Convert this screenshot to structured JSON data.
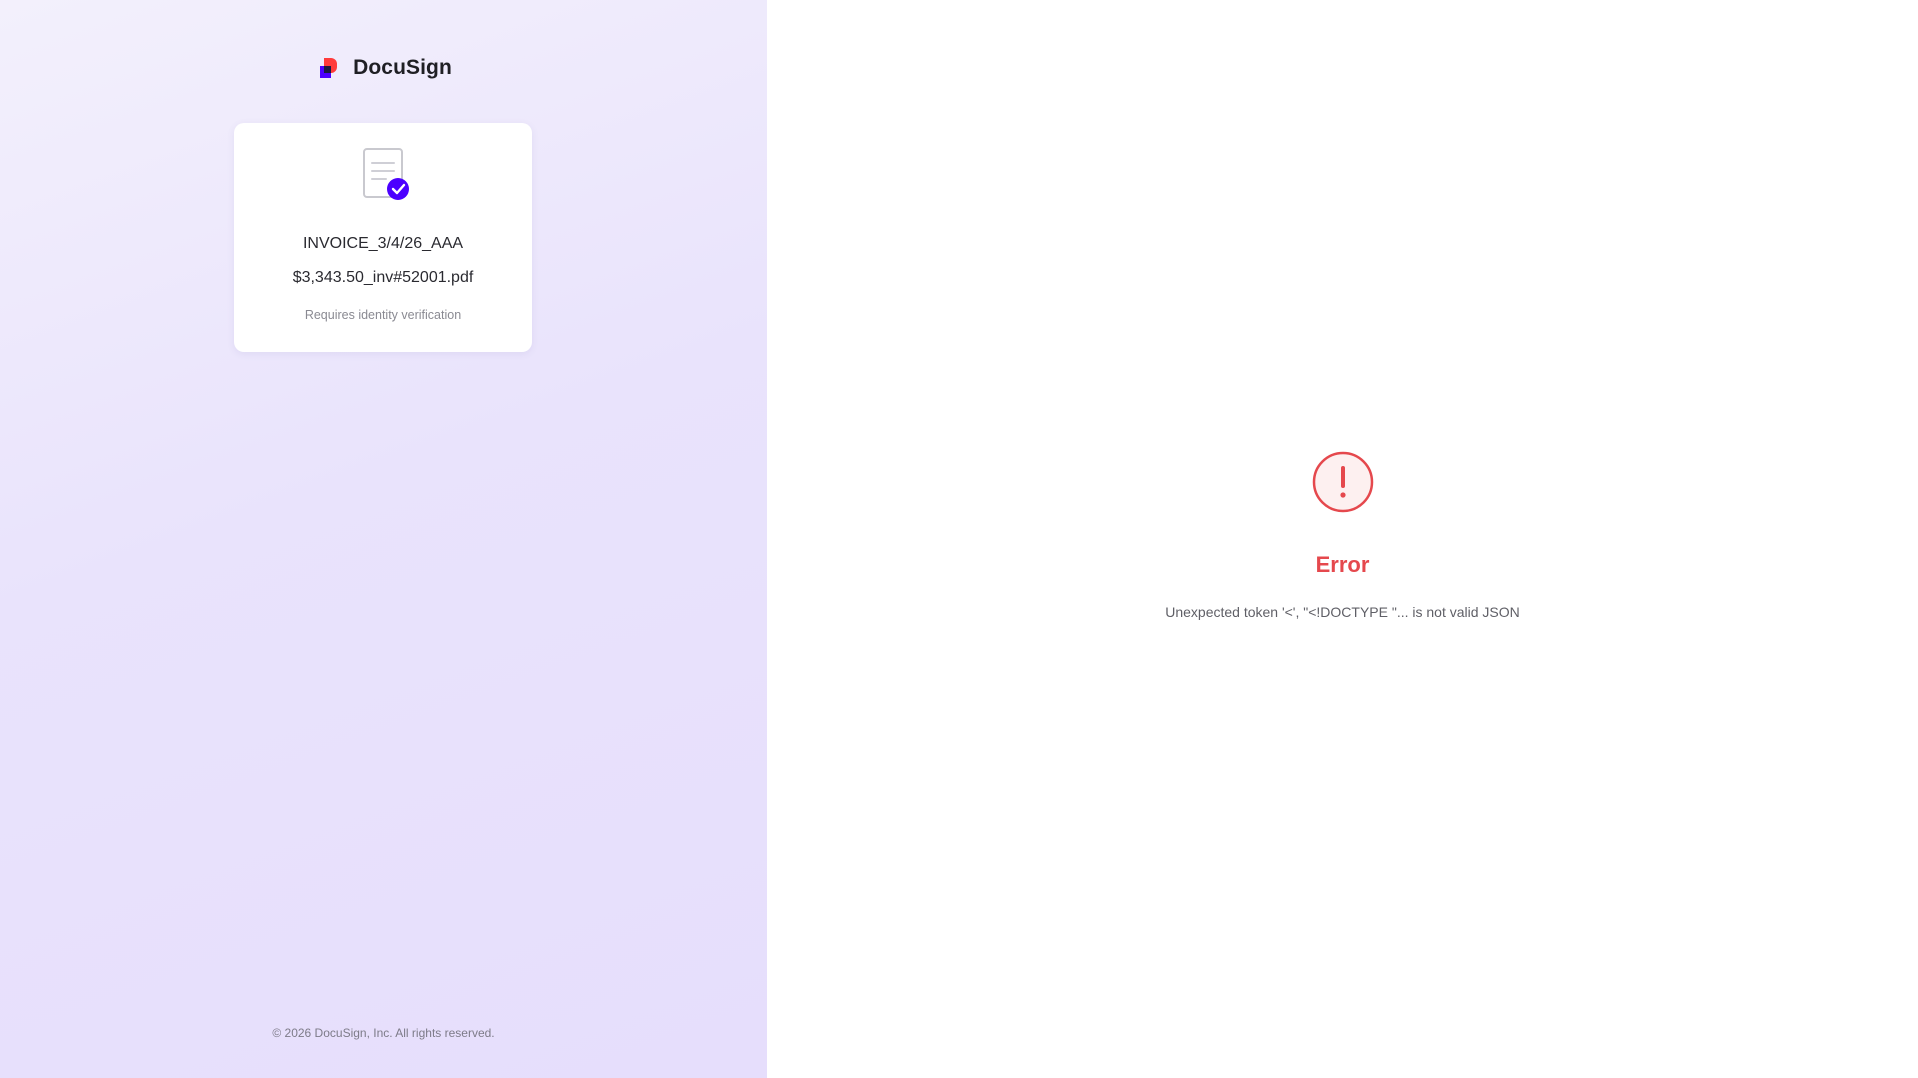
{
  "brand": {
    "name": "DocuSign",
    "logo_colors": {
      "red": "#ff3b3b",
      "purple": "#4c00ff",
      "dark": "#1a1a40"
    }
  },
  "document": {
    "name_line_1": "INVOICE_3/4/26_AAA",
    "name_line_2": "$3,343.50_inv#52001.pdf",
    "note": "Requires identity verification",
    "badge_color": "#4c00ff"
  },
  "footer": {
    "copyright": "© 2026 DocuSign, Inc. All rights reserved."
  },
  "error": {
    "title": "Error",
    "message": "Unexpected token '<', \"<!DOCTYPE \"... is not valid JSON",
    "color": "#e5484d",
    "icon": "exclamation-circle-icon"
  }
}
